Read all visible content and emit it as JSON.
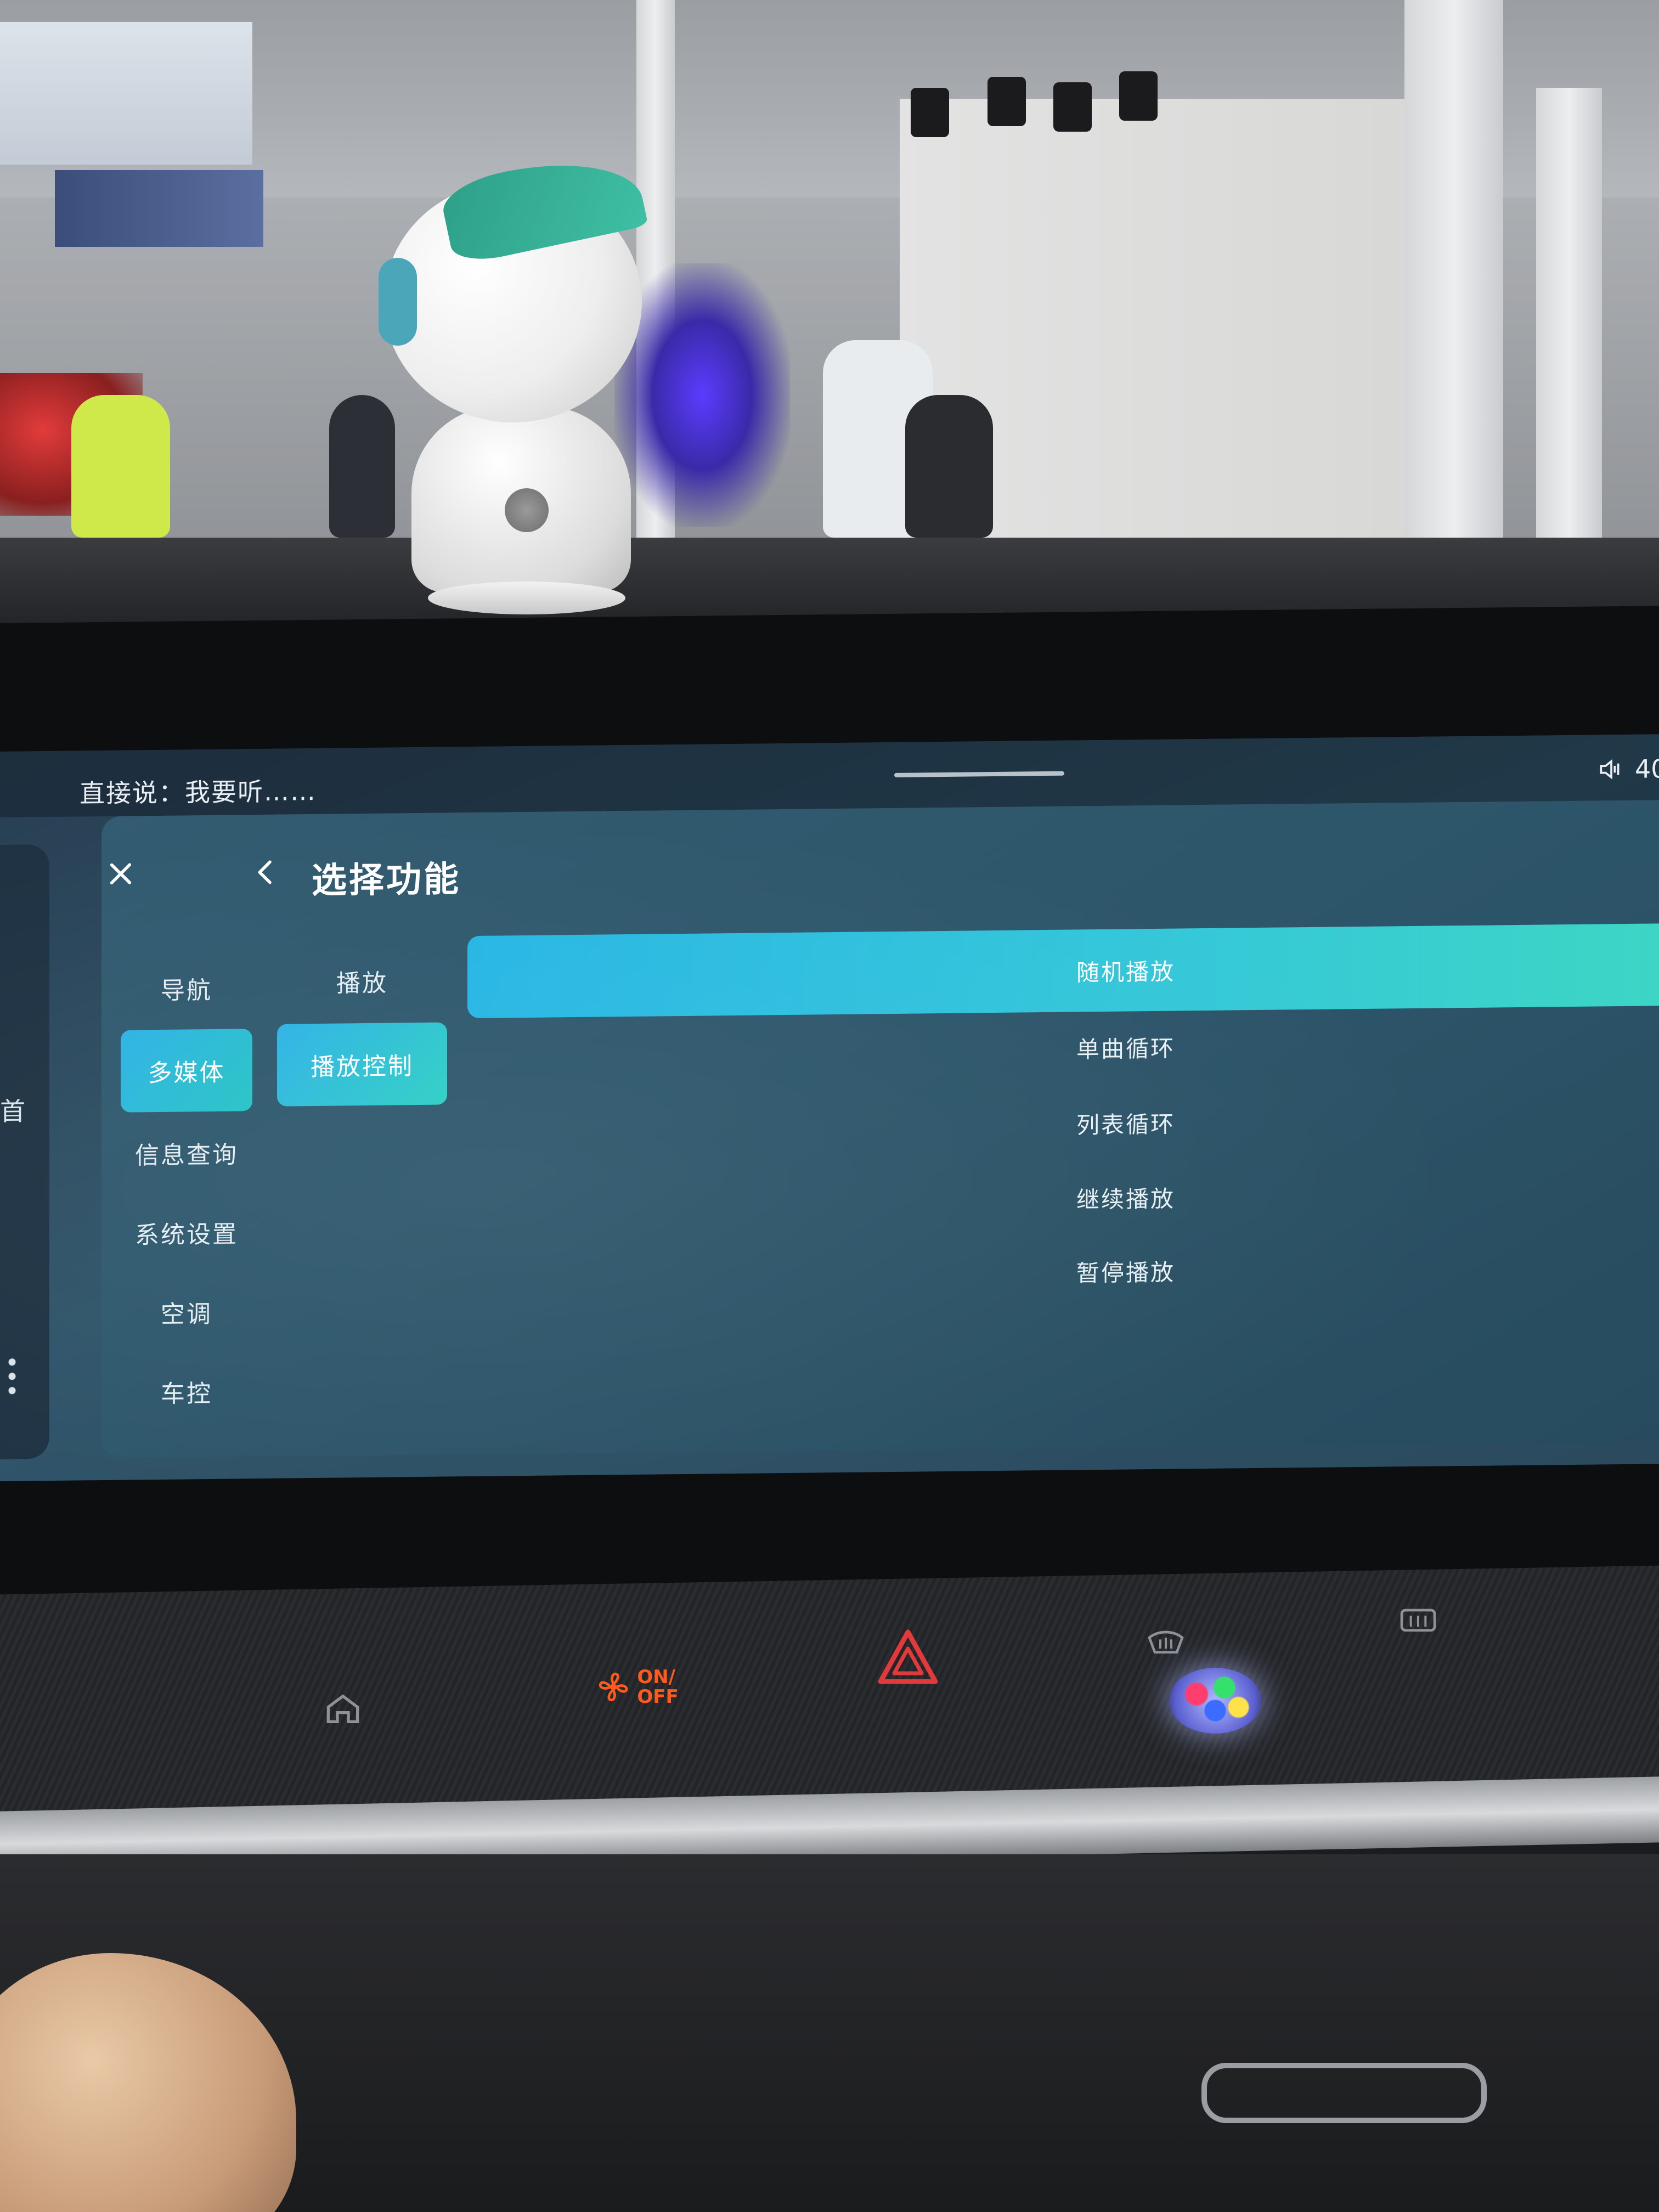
{
  "topbar": {
    "voice_hint": "直接说：我要听……",
    "status_value": "40"
  },
  "panel": {
    "title": "选择功能"
  },
  "categories": [
    {
      "label": "导航",
      "active": false
    },
    {
      "label": "多媒体",
      "active": true
    },
    {
      "label": "信息查询",
      "active": false
    },
    {
      "label": "系统设置",
      "active": false
    },
    {
      "label": "空调",
      "active": false
    },
    {
      "label": "车控",
      "active": false
    }
  ],
  "subcategories": [
    {
      "label": "播放",
      "active": false
    },
    {
      "label": "播放控制",
      "active": true
    }
  ],
  "options": [
    {
      "label": "随机播放",
      "active": true
    },
    {
      "label": "单曲循环",
      "active": false
    },
    {
      "label": "列表循环",
      "active": false
    },
    {
      "label": "继续播放",
      "active": false
    },
    {
      "label": "暂停播放",
      "active": false
    }
  ],
  "sidebar_stub": {
    "char": "首"
  },
  "console": {
    "fan_label_line1": "ON/",
    "fan_label_line2": "OFF"
  },
  "colors": {
    "accent": "#2fb2e6",
    "accent_end": "#3dd6c4",
    "screen_bg": "#2f5469",
    "hazard": "#e23a3a",
    "fan_orange": "#ff5a1e"
  },
  "icons": {
    "close": "close-icon",
    "back": "chevron-left-icon",
    "speaker": "speaker-icon",
    "home": "home-icon",
    "fan": "fan-icon",
    "hazard": "hazard-icon",
    "front_defrost": "front-defrost-icon",
    "rear_defrost": "rear-defrost-icon"
  }
}
